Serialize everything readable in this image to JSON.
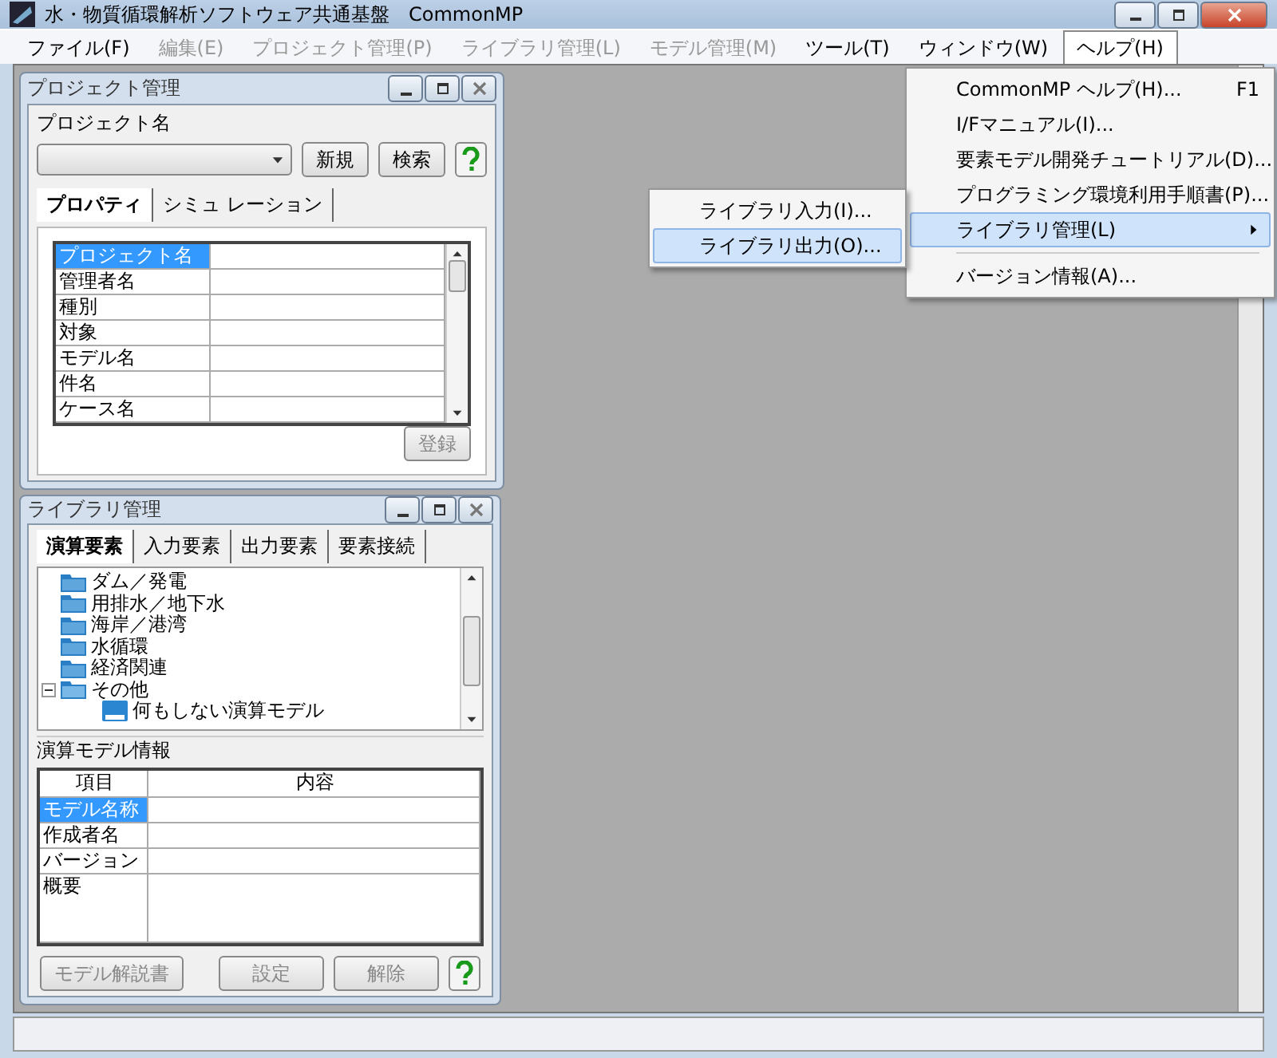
{
  "window": {
    "title": "水・物質循環解析ソフトウェア共通基盤　CommonMP"
  },
  "menubar": [
    {
      "label": "ファイル(F)",
      "disabled": false,
      "selected": false
    },
    {
      "label": "編集(E)",
      "disabled": true,
      "selected": false
    },
    {
      "label": "プロジェクト管理(P)",
      "disabled": true,
      "selected": false
    },
    {
      "label": "ライブラリ管理(L)",
      "disabled": true,
      "selected": false
    },
    {
      "label": "モデル管理(M)",
      "disabled": true,
      "selected": false
    },
    {
      "label": "ツール(T)",
      "disabled": false,
      "selected": false
    },
    {
      "label": "ウィンドウ(W)",
      "disabled": false,
      "selected": false
    },
    {
      "label": "ヘルプ(H)",
      "disabled": false,
      "selected": true
    }
  ],
  "help_menu": [
    {
      "kind": "item",
      "label": "CommonMP ヘルプ(H)...",
      "shortcut": "F1",
      "selected": false
    },
    {
      "kind": "item",
      "label": "I/Fマニュアル(I)...",
      "selected": false
    },
    {
      "kind": "item",
      "label": "要素モデル開発チュートリアル(D)...",
      "selected": false
    },
    {
      "kind": "item",
      "label": "プログラミング環境利用手順書(P)...",
      "selected": false
    },
    {
      "kind": "submenu",
      "label": "ライブラリ管理(L)",
      "selected": true
    },
    {
      "kind": "separator"
    },
    {
      "kind": "item",
      "label": "バージョン情報(A)...",
      "selected": false
    }
  ],
  "library_submenu": [
    {
      "label": "ライブラリ入力(I)...",
      "selected": false
    },
    {
      "label": "ライブラリ出力(O)...",
      "selected": true
    }
  ],
  "project_panel": {
    "title": "プロジェクト管理",
    "name_label": "プロジェクト名",
    "buttons": [
      "新規",
      "検索"
    ],
    "tabs": [
      {
        "label": "プロパティ",
        "selected": true
      },
      {
        "label": "シミュ レーション",
        "selected": false
      }
    ],
    "properties": [
      {
        "label": "プロジェクト名",
        "selected": true
      },
      {
        "label": "管理者名",
        "selected": false
      },
      {
        "label": "種別",
        "selected": false
      },
      {
        "label": "対象",
        "selected": false
      },
      {
        "label": "モデル名",
        "selected": false
      },
      {
        "label": "件名",
        "selected": false
      },
      {
        "label": "ケース名",
        "selected": false
      }
    ],
    "register_button": {
      "label": "登録",
      "disabled": true
    }
  },
  "library_panel": {
    "title": "ライブラリ管理",
    "tabs": [
      {
        "label": "演算要素",
        "selected": true
      },
      {
        "label": "入力要素",
        "selected": false
      },
      {
        "label": "出力要素",
        "selected": false
      },
      {
        "label": "要素接続",
        "selected": false
      }
    ],
    "tree": [
      {
        "label": "ダム／発電"
      },
      {
        "label": "用排水／地下水"
      },
      {
        "label": "海岸／港湾"
      },
      {
        "label": "水循環"
      },
      {
        "label": "経済関連"
      },
      {
        "label": "その他",
        "expanded": true,
        "children": [
          {
            "label": "何もしない演算モデル"
          }
        ]
      }
    ],
    "info_title": "演算モデル情報",
    "columns": [
      "項目",
      "内容"
    ],
    "info_rows": [
      {
        "label": "モデル名称",
        "selected": true
      },
      {
        "label": "作成者名",
        "selected": false
      },
      {
        "label": "バージョン",
        "selected": false
      },
      {
        "label": "概要",
        "selected": false
      }
    ],
    "buttons": [
      {
        "label": "モデル解説書",
        "disabled": true
      },
      {
        "label": "設定",
        "disabled": true
      },
      {
        "label": "解除",
        "disabled": true
      }
    ]
  }
}
